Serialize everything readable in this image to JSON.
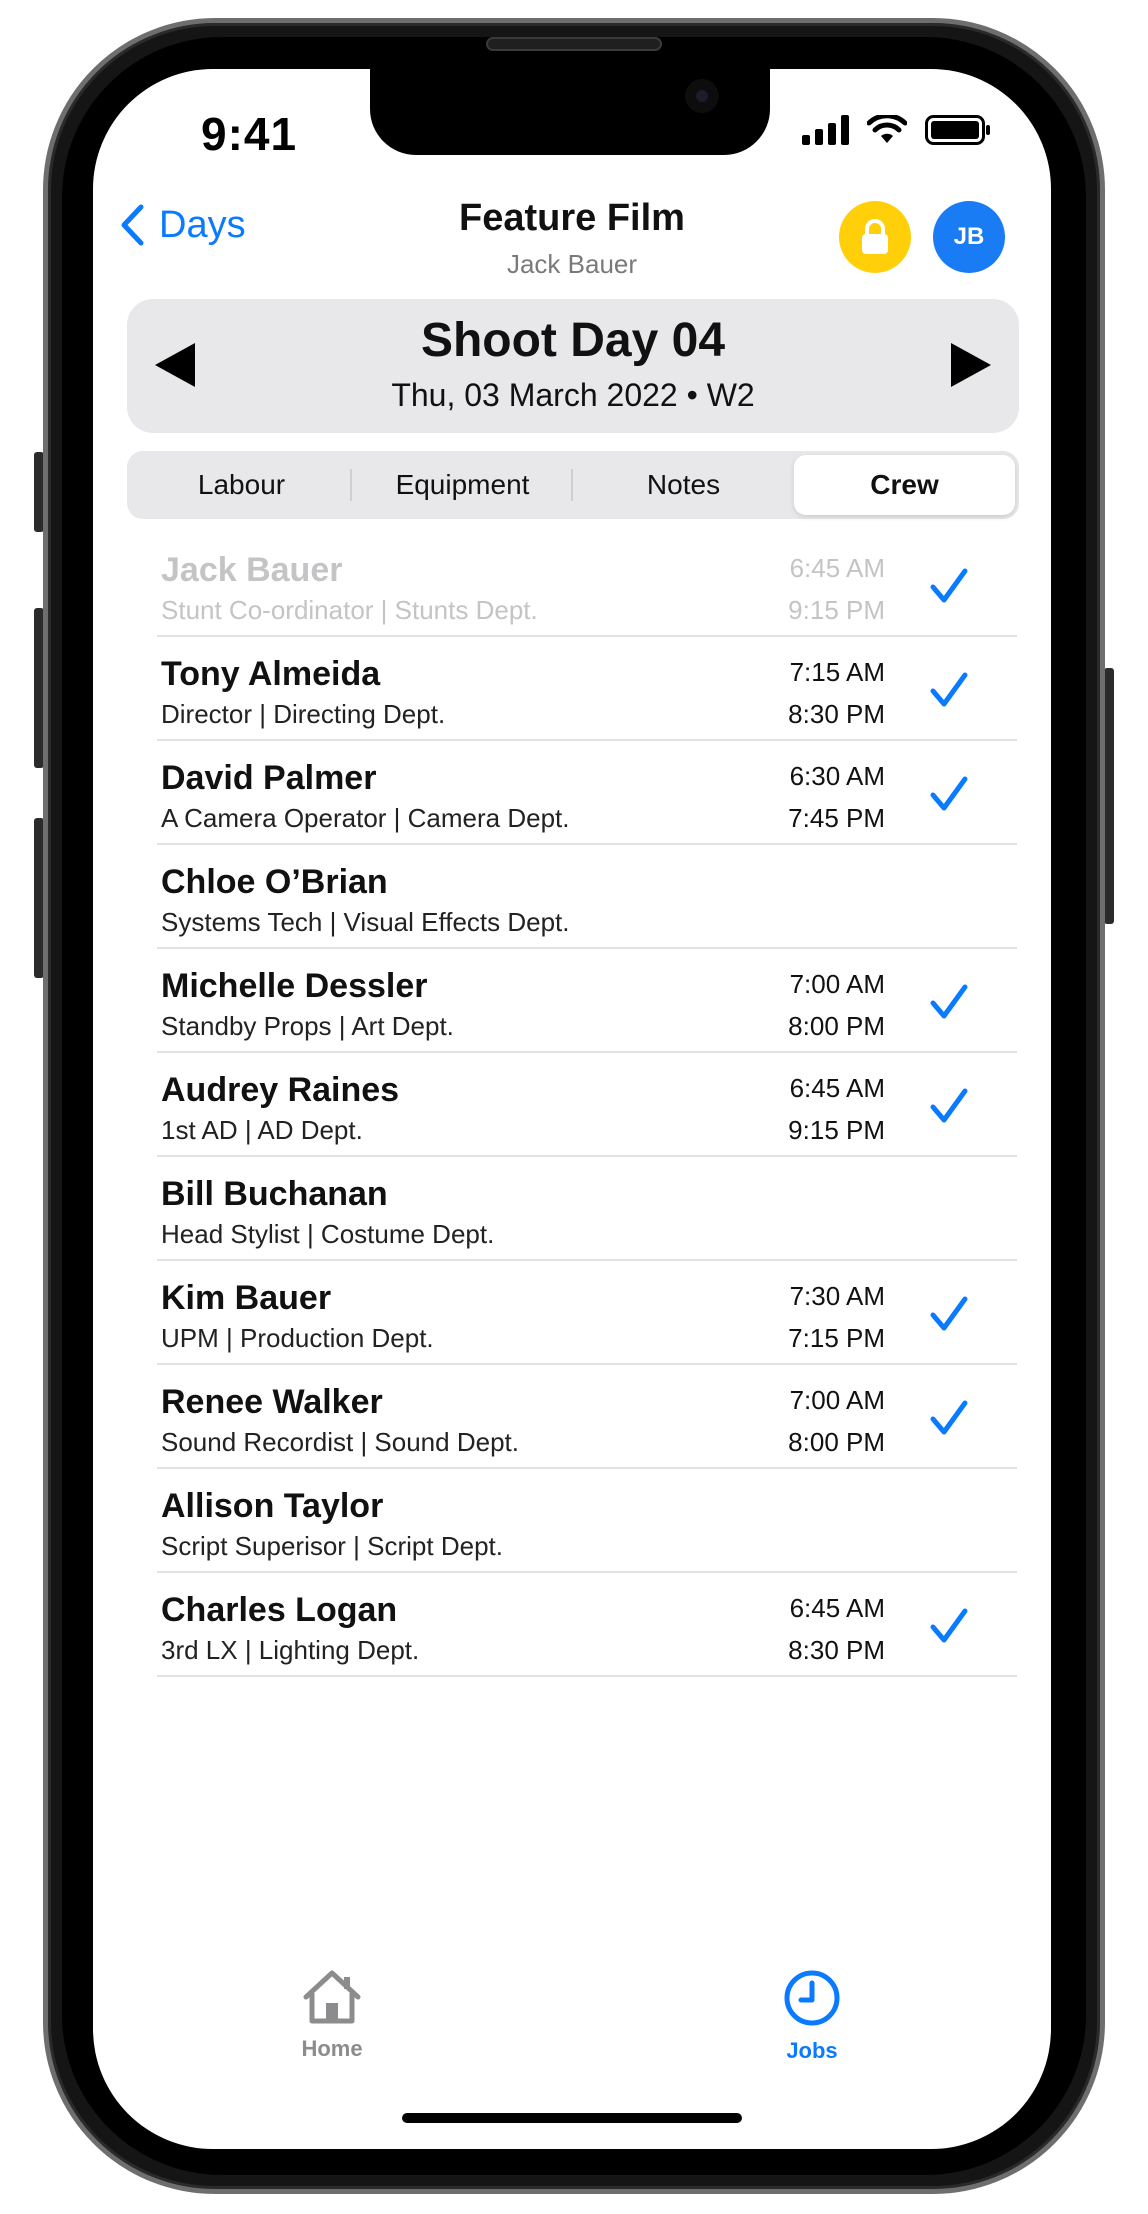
{
  "status": {
    "time": "9:41"
  },
  "nav": {
    "back_label": "Days",
    "title": "Feature Film",
    "subtitle": "Jack Bauer",
    "avatar_initials": "JB"
  },
  "day": {
    "title": "Shoot Day 04",
    "date": "Thu, 03 March 2022 • W2"
  },
  "tabs": [
    {
      "label": "Labour",
      "active": false
    },
    {
      "label": "Equipment",
      "active": false
    },
    {
      "label": "Notes",
      "active": false
    },
    {
      "label": "Crew",
      "active": true
    }
  ],
  "crew": [
    {
      "name": "Jack Bauer",
      "role": "Stunt Co-ordinator | Stunts Dept.",
      "in": "6:45 AM",
      "out": "9:15 PM",
      "checked": true,
      "dimmed": true
    },
    {
      "name": "Tony Almeida",
      "role": "Director | Directing Dept.",
      "in": "7:15 AM",
      "out": "8:30 PM",
      "checked": true
    },
    {
      "name": "David Palmer",
      "role": "A Camera Operator | Camera Dept.",
      "in": "6:30 AM",
      "out": "7:45 PM",
      "checked": true
    },
    {
      "name": "Chloe O’Brian",
      "role": "Systems Tech | Visual Effects Dept.",
      "in": "",
      "out": "",
      "checked": false
    },
    {
      "name": "Michelle Dessler",
      "role": "Standby Props | Art Dept.",
      "in": "7:00 AM",
      "out": "8:00 PM",
      "checked": true
    },
    {
      "name": "Audrey Raines",
      "role": "1st AD | AD Dept.",
      "in": "6:45 AM",
      "out": "9:15 PM",
      "checked": true
    },
    {
      "name": "Bill Buchanan",
      "role": "Head Stylist | Costume Dept.",
      "in": "",
      "out": "",
      "checked": false
    },
    {
      "name": "Kim Bauer",
      "role": "UPM | Production Dept.",
      "in": "7:30 AM",
      "out": "7:15 PM",
      "checked": true
    },
    {
      "name": "Renee Walker",
      "role": "Sound Recordist | Sound Dept.",
      "in": "7:00 AM",
      "out": "8:00 PM",
      "checked": true
    },
    {
      "name": "Allison Taylor",
      "role": "Script Superisor | Script Dept.",
      "in": "",
      "out": "",
      "checked": false
    },
    {
      "name": "Charles Logan",
      "role": "3rd LX | Lighting Dept.",
      "in": "6:45 AM",
      "out": "8:30 PM",
      "checked": true
    }
  ],
  "tabbar": {
    "home_label": "Home",
    "jobs_label": "Jobs"
  },
  "colors": {
    "accent": "#0a7aff",
    "lock": "#ffcf09",
    "avatar": "#1a7cf5"
  },
  "icons": {
    "back": "chevron-left-icon",
    "lock": "lock-icon",
    "check": "checkmark-icon",
    "home": "house-icon",
    "jobs": "clock-icon"
  }
}
